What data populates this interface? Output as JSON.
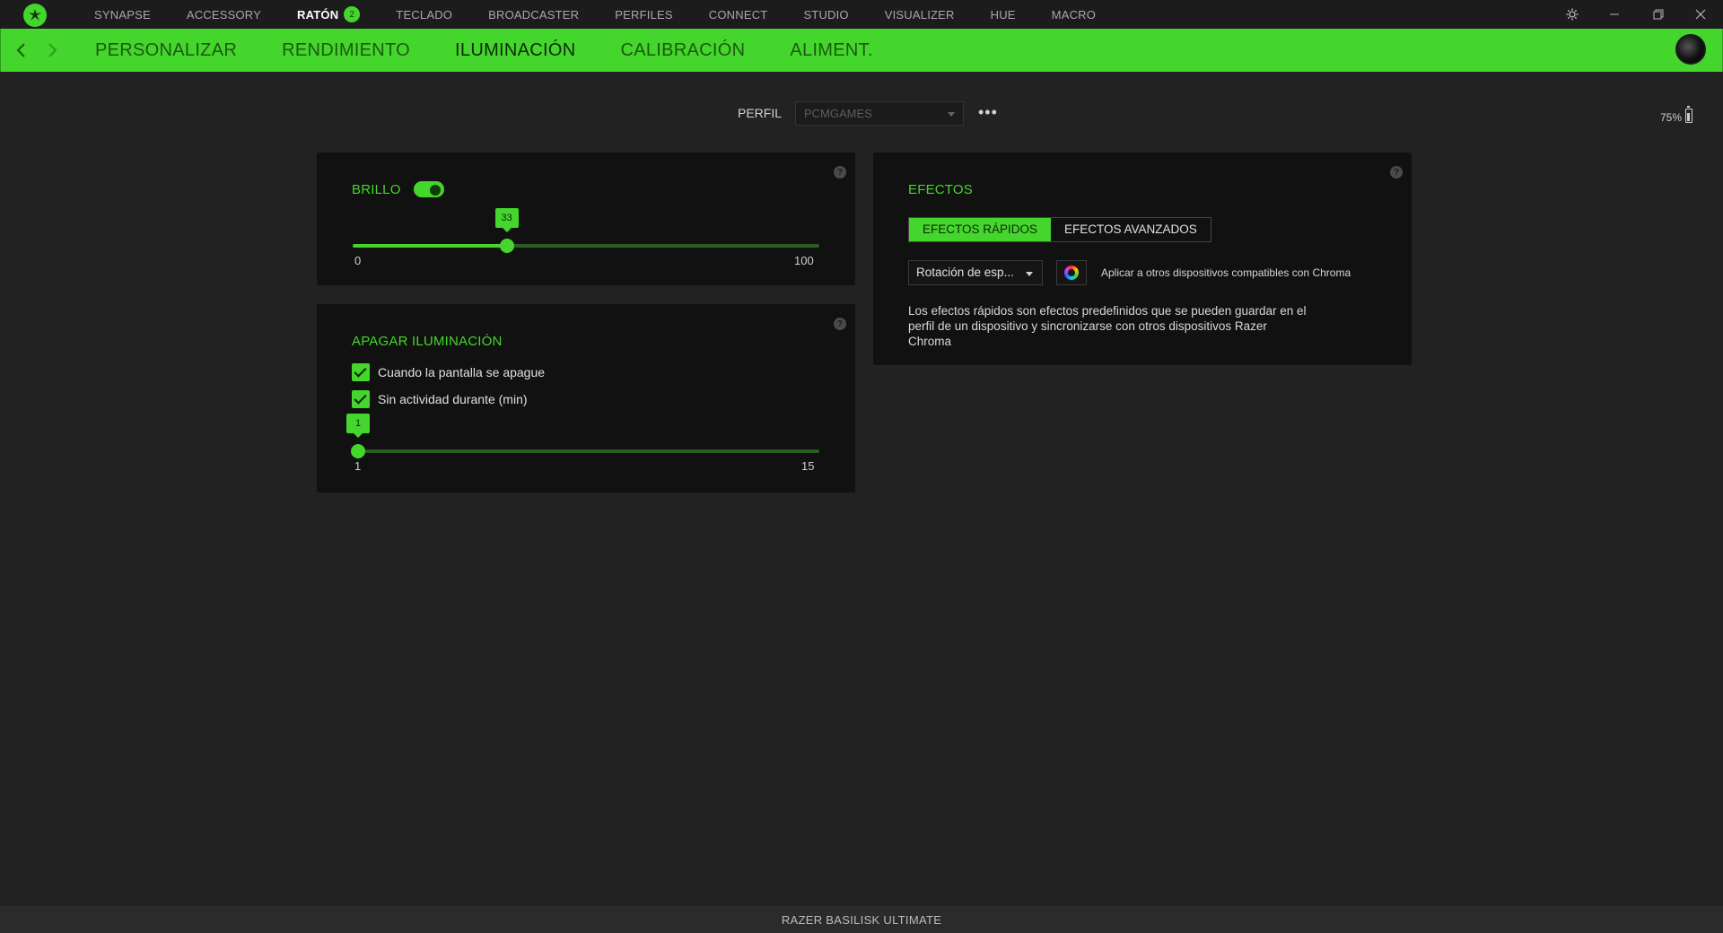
{
  "top_nav": {
    "items": [
      {
        "label": "SYNAPSE"
      },
      {
        "label": "ACCESSORY"
      },
      {
        "label": "RATÓN",
        "badge": "2"
      },
      {
        "label": "TECLADO"
      },
      {
        "label": "BROADCASTER"
      },
      {
        "label": "PERFILES"
      },
      {
        "label": "CONNECT"
      },
      {
        "label": "STUDIO"
      },
      {
        "label": "VISUALIZER"
      },
      {
        "label": "HUE"
      },
      {
        "label": "MACRO"
      }
    ],
    "active_index": 2
  },
  "window_controls": [
    "settings-icon",
    "minimize-icon",
    "restore-icon",
    "close-icon"
  ],
  "sub_nav": {
    "items": [
      {
        "label": "PERSONALIZAR"
      },
      {
        "label": "RENDIMIENTO"
      },
      {
        "label": "ILUMINACIÓN"
      },
      {
        "label": "CALIBRACIÓN"
      },
      {
        "label": "ALIMENT."
      }
    ],
    "active_index": 2
  },
  "profile": {
    "label": "PERFIL",
    "value": "PCMGAMES",
    "more": "•••"
  },
  "battery": {
    "level_text": "75%"
  },
  "brillo": {
    "title": "BRILLO",
    "enabled": true,
    "value": "33",
    "min": "0",
    "max": "100",
    "value_num": 33
  },
  "apagar": {
    "title": "APAGAR ILUMINACIÓN",
    "options": [
      {
        "label": "Cuando la pantalla se apague",
        "checked": true
      },
      {
        "label": "Sin actividad durante (min)",
        "checked": true
      }
    ],
    "value": "1",
    "min": "1",
    "max": "15",
    "value_num": 1
  },
  "efectos": {
    "title": "EFECTOS",
    "tabs": [
      {
        "label": "EFECTOS RÁPIDOS",
        "active": true
      },
      {
        "label": "EFECTOS AVANZADOS",
        "active": false
      }
    ],
    "selected_effect": "Rotación de esp...",
    "apply_label": "Aplicar a otros dispositivos compatibles con Chroma",
    "description_lines": [
      "Los efectos rápidos son efectos predefinidos que se pueden guardar en el",
      "perfil de un dispositivo y sincronizarse con otros dispositivos Razer",
      "Chroma"
    ]
  },
  "footer": {
    "device_name": "RAZER BASILISK ULTIMATE"
  },
  "colors": {
    "accent": "#44d62c",
    "background": "#222222",
    "panel": "#111111"
  }
}
